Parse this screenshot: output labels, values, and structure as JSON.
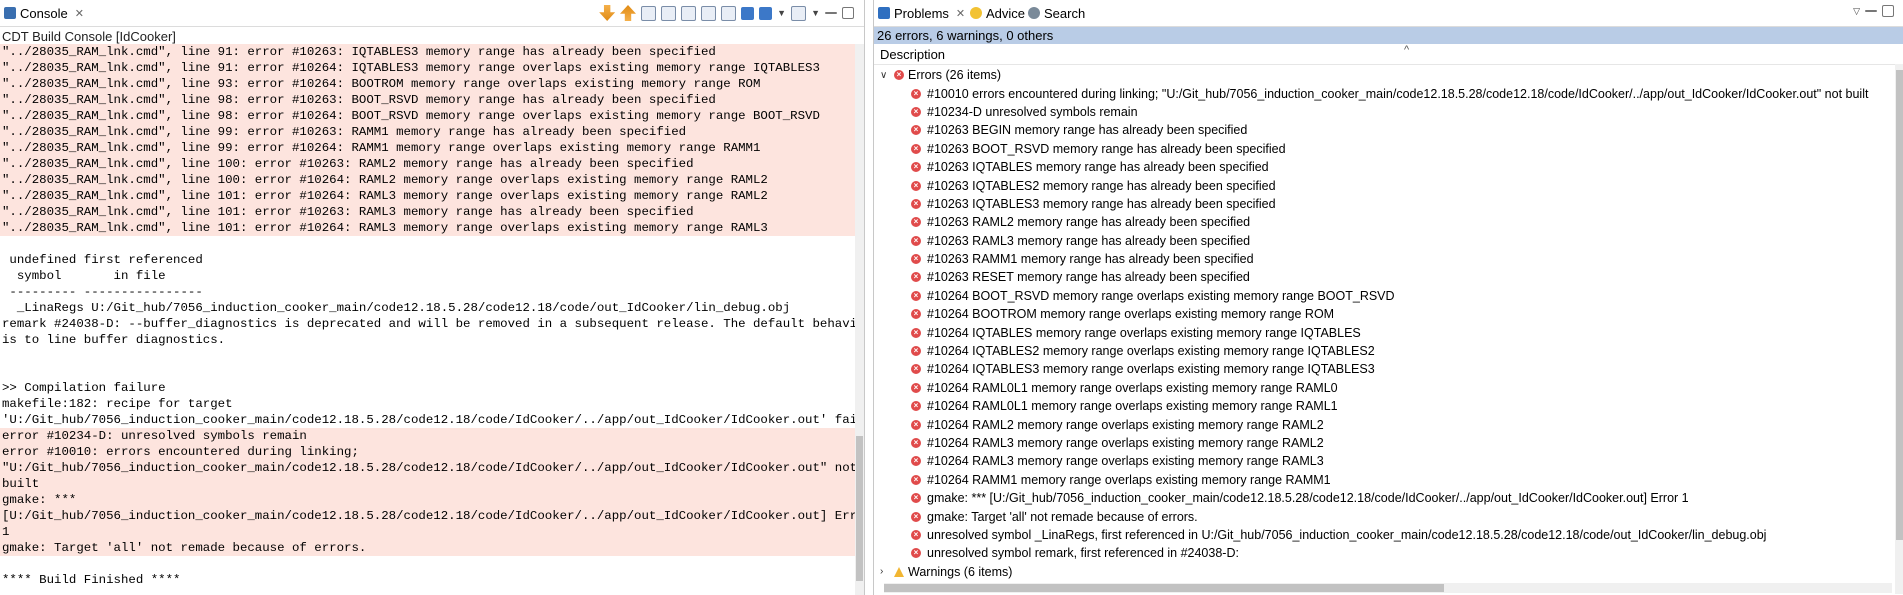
{
  "console": {
    "tab_label": "Console",
    "title": "CDT Build Console [IdCooker]",
    "lines": [
      {
        "text": "\"../28035_RAM_lnk.cmd\", line 91: error #10263: IQTABLES3 memory range has already been specified",
        "error": true
      },
      {
        "text": "\"../28035_RAM_lnk.cmd\", line 91: error #10264: IQTABLES3 memory range overlaps existing memory range IQTABLES3",
        "error": true
      },
      {
        "text": "\"../28035_RAM_lnk.cmd\", line 93: error #10264: BOOTROM memory range overlaps existing memory range ROM",
        "error": true
      },
      {
        "text": "\"../28035_RAM_lnk.cmd\", line 98: error #10263: BOOT_RSVD memory range has already been specified",
        "error": true
      },
      {
        "text": "\"../28035_RAM_lnk.cmd\", line 98: error #10264: BOOT_RSVD memory range overlaps existing memory range BOOT_RSVD",
        "error": true
      },
      {
        "text": "\"../28035_RAM_lnk.cmd\", line 99: error #10263: RAMM1 memory range has already been specified",
        "error": true
      },
      {
        "text": "\"../28035_RAM_lnk.cmd\", line 99: error #10264: RAMM1 memory range overlaps existing memory range RAMM1",
        "error": true
      },
      {
        "text": "\"../28035_RAM_lnk.cmd\", line 100: error #10263: RAML2 memory range has already been specified",
        "error": true
      },
      {
        "text": "\"../28035_RAM_lnk.cmd\", line 100: error #10264: RAML2 memory range overlaps existing memory range RAML2",
        "error": true
      },
      {
        "text": "\"../28035_RAM_lnk.cmd\", line 101: error #10264: RAML3 memory range overlaps existing memory range RAML2",
        "error": true
      },
      {
        "text": "\"../28035_RAM_lnk.cmd\", line 101: error #10263: RAML3 memory range has already been specified",
        "error": true
      },
      {
        "text": "\"../28035_RAM_lnk.cmd\", line 101: error #10264: RAML3 memory range overlaps existing memory range RAML3",
        "error": true
      },
      {
        "text": "",
        "error": false
      },
      {
        "text": " undefined first referenced",
        "error": false
      },
      {
        "text": "  symbol       in file",
        "error": false
      },
      {
        "text": " --------- ----------------",
        "error": false
      },
      {
        "text": "  _LinaRegs U:/Git_hub/7056_induction_cooker_main/code12.18.5.28/code12.18/code/out_IdCooker/lin_debug.obj",
        "error": false
      },
      {
        "text": "remark #24038-D: --buffer_diagnostics is deprecated and will be removed in a subsequent release. The default behavior",
        "error": false
      },
      {
        "text": "is to line buffer diagnostics.",
        "error": false
      },
      {
        "text": "",
        "error": false
      },
      {
        "text": "",
        "error": false
      },
      {
        "text": ">> Compilation failure",
        "error": false
      },
      {
        "text": "makefile:182: recipe for target",
        "error": false
      },
      {
        "text": "'U:/Git_hub/7056_induction_cooker_main/code12.18.5.28/code12.18/code/IdCooker/../app/out_IdCooker/IdCooker.out' failed",
        "error": false
      },
      {
        "text": "error #10234-D: unresolved symbols remain",
        "error": true
      },
      {
        "text": "error #10010: errors encountered during linking;",
        "error": true
      },
      {
        "text": "\"U:/Git_hub/7056_induction_cooker_main/code12.18.5.28/code12.18/code/IdCooker/../app/out_IdCooker/IdCooker.out\" not",
        "error": true
      },
      {
        "text": "built",
        "error": true
      },
      {
        "text": "gmake: ***",
        "error": true
      },
      {
        "text": "[U:/Git_hub/7056_induction_cooker_main/code12.18.5.28/code12.18/code/IdCooker/../app/out_IdCooker/IdCooker.out] Error",
        "error": true
      },
      {
        "text": "1",
        "error": true
      },
      {
        "text": "gmake: Target 'all' not remade because of errors.",
        "error": true
      },
      {
        "text": "",
        "error": false
      },
      {
        "text": "**** Build Finished ****",
        "error": false
      }
    ]
  },
  "problems": {
    "tabs": [
      {
        "label": "Problems",
        "icon": "problems-icon",
        "color": "#2f6fc0"
      },
      {
        "label": "Advice",
        "icon": "lightbulb-icon",
        "color": "#f2c233"
      },
      {
        "label": "Search",
        "icon": "search-icon",
        "color": "#7a8a99"
      }
    ],
    "summary": "26 errors, 6 warnings, 0 others",
    "column": "Description",
    "errors_label": "Errors (26 items)",
    "warnings_label": "Warnings (6 items)",
    "errors": [
      "#10010 errors encountered during linking; \"U:/Git_hub/7056_induction_cooker_main/code12.18.5.28/code12.18/code/IdCooker/../app/out_IdCooker/IdCooker.out\" not built",
      "#10234-D unresolved symbols remain",
      "#10263 BEGIN memory range has already been specified",
      "#10263 BOOT_RSVD memory range has already been specified",
      "#10263 IQTABLES memory range has already been specified",
      "#10263 IQTABLES2 memory range has already been specified",
      "#10263 IQTABLES3 memory range has already been specified",
      "#10263 RAML2 memory range has already been specified",
      "#10263 RAML3 memory range has already been specified",
      "#10263 RAMM1 memory range has already been specified",
      "#10263 RESET memory range has already been specified",
      "#10264 BOOT_RSVD memory range overlaps existing memory range BOOT_RSVD",
      "#10264 BOOTROM memory range overlaps existing memory range ROM",
      "#10264 IQTABLES memory range overlaps existing memory range IQTABLES",
      "#10264 IQTABLES2 memory range overlaps existing memory range IQTABLES2",
      "#10264 IQTABLES3 memory range overlaps existing memory range IQTABLES3",
      "#10264 RAML0L1 memory range overlaps existing memory range RAML0",
      "#10264 RAML0L1 memory range overlaps existing memory range RAML1",
      "#10264 RAML2 memory range overlaps existing memory range RAML2",
      "#10264 RAML3 memory range overlaps existing memory range RAML2",
      "#10264 RAML3 memory range overlaps existing memory range RAML3",
      "#10264 RAMM1 memory range overlaps existing memory range RAMM1",
      "gmake: *** [U:/Git_hub/7056_induction_cooker_main/code12.18.5.28/code12.18/code/IdCooker/../app/out_IdCooker/IdCooker.out] Error 1",
      "gmake: Target 'all' not remade because of errors.",
      "unresolved symbol _LinaRegs, first referenced in U:/Git_hub/7056_induction_cooker_main/code12.18.5.28/code12.18/code/out_IdCooker/lin_debug.obj",
      "unresolved symbol remark, first referenced in #24038-D:"
    ]
  }
}
